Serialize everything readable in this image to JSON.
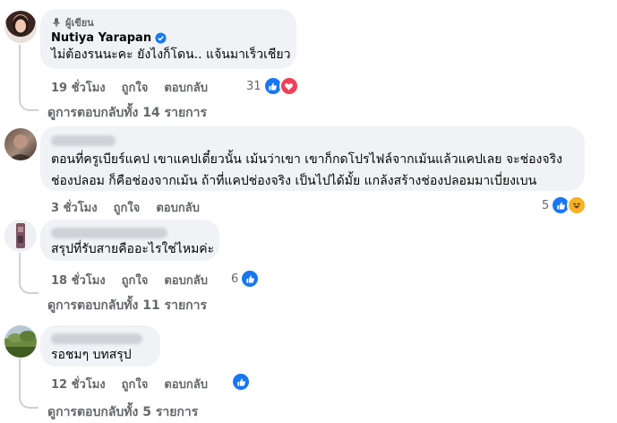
{
  "comments": [
    {
      "badge": "ผู้เขียน",
      "author": "Nutiya Yarapan",
      "text": [
        "ไม่ต้องรนนะคะ ยังไงก็โดน.. แจ้นมาเร็วเชียว"
      ],
      "time": "19 ชั่วโมง",
      "like": "ถูกใจ",
      "reply": "ตอบกลับ",
      "reaction_count": "31",
      "reactions": [
        "like-icon",
        "love-icon"
      ],
      "view_replies": "ดูการตอบกลับทั้ง 14 รายการ"
    },
    {
      "author_blurred": true,
      "text": [
        "ตอนที่ครูเบียร์แคป เขาแคปเดี๋ยวนั้น เม้นว่าเขา เขาก็กดโปรไฟล์จากเม้นแล้วแคปเลย จะช่องจริง",
        "ช่องปลอม ก็คือช่องจากเม้น ถ้าที่แคปช่องจริง เป็นไปได้มั้ย แกล้งสร้างช่องปลอมมาเบี่ยงเบน"
      ],
      "time": "3 ชั่วโมง",
      "like": "ถูกใจ",
      "reply": "ตอบกลับ",
      "reaction_count": "5",
      "reactions": [
        "like-icon",
        "laugh-icon"
      ]
    },
    {
      "author_blurred": true,
      "text": [
        "สรุปที่รับสายคืออะไรใช่ไหมค่ะ"
      ],
      "time": "18 ชั่วโมง",
      "like": "ถูกใจ",
      "reply": "ตอบกลับ",
      "reaction_count": "6",
      "reactions": [
        "like-icon"
      ],
      "view_replies": "ดูการตอบกลับทั้ง 11 รายการ"
    },
    {
      "author_blurred": true,
      "text": [
        "รอชมๆ บทสรุป"
      ],
      "time": "12 ชั่วโมง",
      "like": "ถูกใจ",
      "reply": "ตอบกลับ",
      "reaction_count": "",
      "reactions": [
        "like-icon"
      ],
      "view_replies": "ดูการตอบกลับทั้ง 5 รายการ"
    }
  ],
  "colors": {
    "like_blue": "#1877f2",
    "love_red": "#f33e58",
    "laugh_yellow": "#f7b125",
    "muted_text": "#65676b",
    "bubble_bg": "#f0f2f5"
  }
}
